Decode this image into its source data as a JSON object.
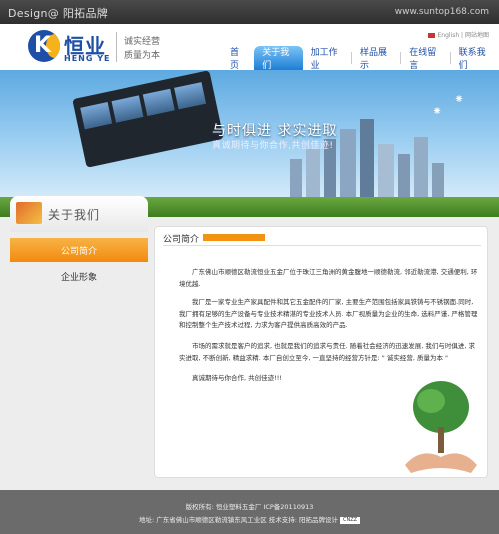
{
  "top": {
    "design": "Design@ 阳拓品牌",
    "url": "www.suntop168.com"
  },
  "header": {
    "brand_cn": "恒业",
    "brand_en": "HENG YE",
    "slogan1": "诚实经营",
    "slogan2": "质量为本",
    "lang": "English | 网站地图",
    "nav": [
      "首页",
      "关于我们",
      "加工作业",
      "样品展示",
      "在线留言",
      "联系我们"
    ]
  },
  "banner": {
    "title": "与时俱进  求实进取",
    "subtitle": "真诚期待与你合作,共创佳迹!"
  },
  "sidebar": {
    "title": "关于我们",
    "items": [
      "公司简介",
      "企业形象"
    ]
  },
  "content": {
    "title": "公司简介",
    "paragraphs": [
      "广东佛山市顺德区勒流恒业五金厂位于珠江三角洲的黄金腹地一顺德勒流, 邻近勒流港, 交通便利, 环境优越.",
      "我厂是一家专业生产家具配件和其它五金配件的厂家, 主要生产范围包括家具铁铸与不锈钢面.同时, 我厂拥有足够的生产设备与专业技术精湛的专业技术人员. 本厂视质量为企业的生命, 选料严谨, 严格管理和控制整个生产技术过程, 力求为客户提供高质高效的产品.",
      "市场的需求就是客户的追求, 也就是我们的追求与责任. 随着社会经济的迅速发展, 我们与时俱进, 求实进取, 不断创新, 精益求精. 本厂自创立至今, 一直坚持的经营方针是: \" 诚实经营, 质量为本 \"",
      "真诚期待与你合作, 共创佳迹!!!"
    ]
  },
  "footer": {
    "line1": "版权所有: 恒业塑料五金厂  ICP备20110913",
    "line2": "地址: 广东省佛山市顺德区勒流镇东风工业区   技术支持: 阳拓品牌设计",
    "badge": "CNZZ"
  },
  "colors": {
    "brand_blue": "#1e4fa6",
    "accent_orange": "#f29312",
    "nav_active": "#1e7fd6",
    "footer_bg": "#6b6b6b"
  }
}
